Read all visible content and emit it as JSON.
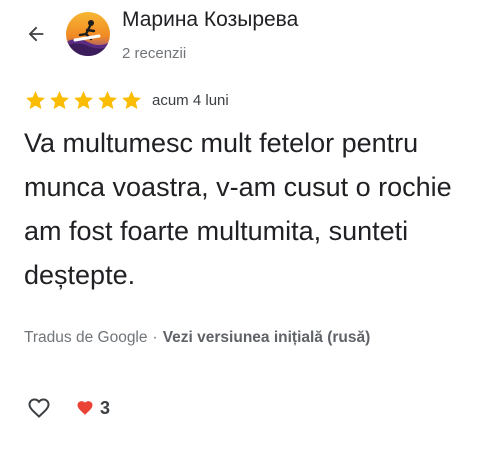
{
  "header": {
    "back_icon": "arrow-left-icon",
    "author_name": "Марина Козырева",
    "review_count": "2 recenzii",
    "avatar_icon": "surfer-avatar-icon"
  },
  "review": {
    "rating": 5,
    "rating_max": 5,
    "date": "acum 4 luni",
    "text": "Va multumesc mult fetelor pentru munca voastra, v-am cusut o rochie am fost foarte multumita, sunteti deștepte."
  },
  "translation": {
    "label": "Tradus de Google",
    "separator": "·",
    "link": "Vezi versiunea inițială (rusă)"
  },
  "actions": {
    "like_icon": "heart-outline-icon",
    "reaction_icon": "heart-filled-icon",
    "reaction_count": "3"
  },
  "colors": {
    "star": "#fbbc04",
    "reaction_heart": "#ea4335",
    "secondary_text": "#70757a",
    "primary_text": "#202124"
  }
}
